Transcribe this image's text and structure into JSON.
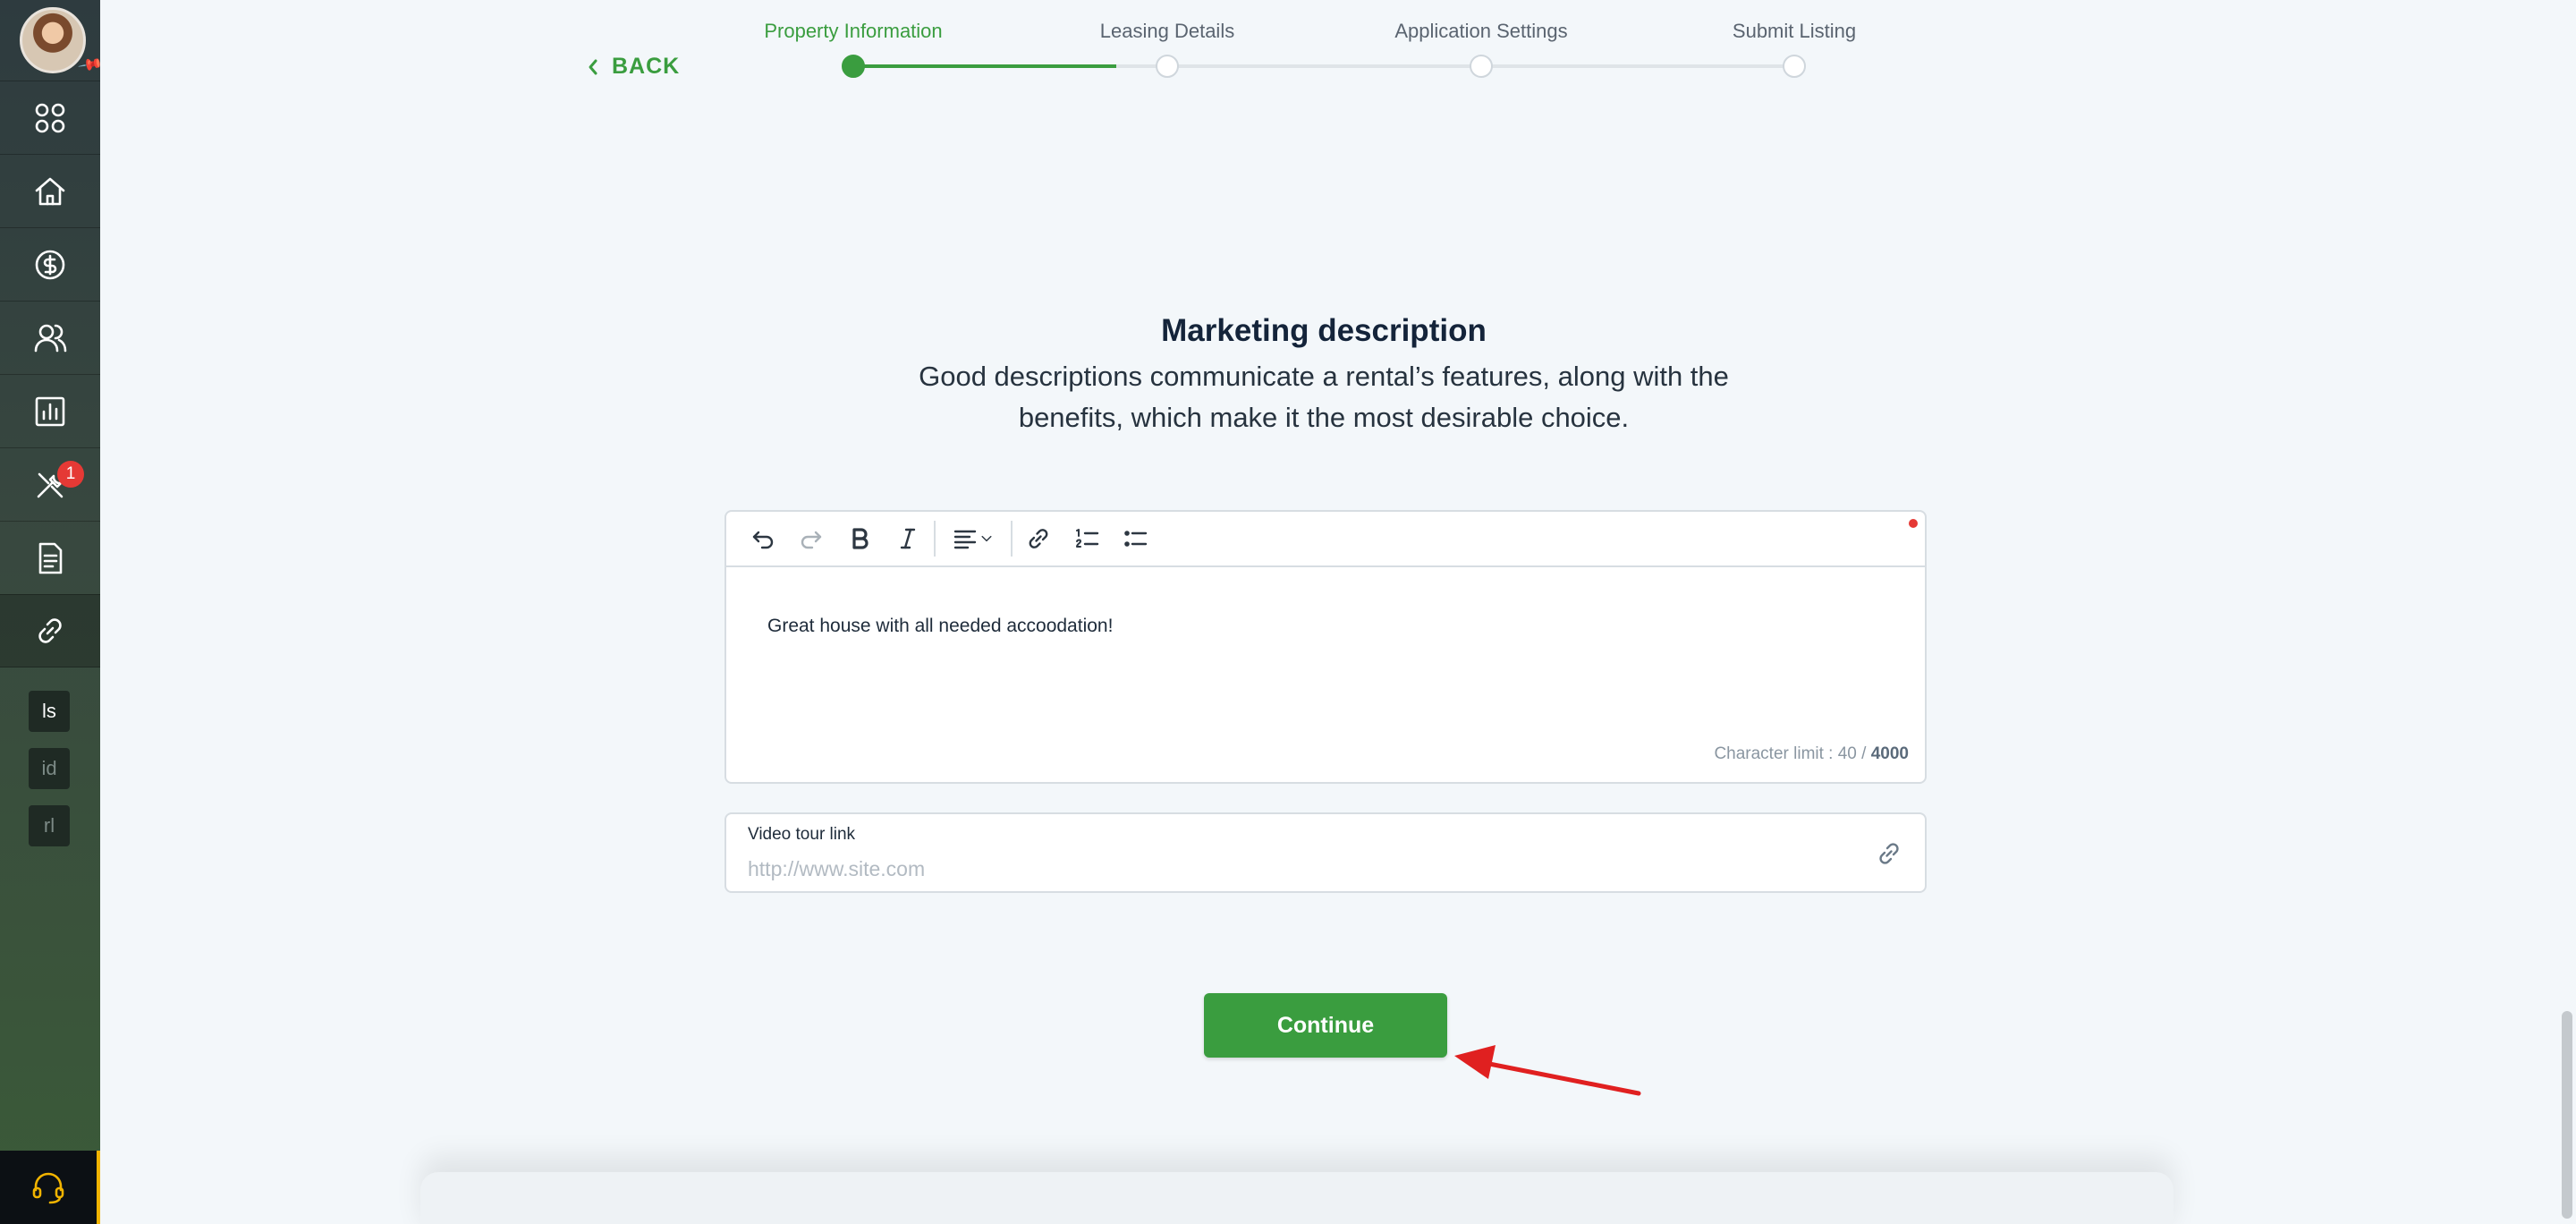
{
  "stepper": {
    "back_label": "BACK",
    "steps": [
      {
        "label": "Property Information",
        "state": "current"
      },
      {
        "label": "Leasing Details",
        "state": "upcoming"
      },
      {
        "label": "Application Settings",
        "state": "upcoming"
      },
      {
        "label": "Submit Listing",
        "state": "upcoming"
      }
    ]
  },
  "sidebar": {
    "items": [
      {
        "icon": "grid-icon"
      },
      {
        "icon": "home-icon"
      },
      {
        "icon": "dollar-icon"
      },
      {
        "icon": "users-icon"
      },
      {
        "icon": "chart-icon"
      },
      {
        "icon": "tools-icon",
        "badge": "1"
      },
      {
        "icon": "document-icon"
      },
      {
        "icon": "link-icon",
        "active": true
      }
    ],
    "mini_items": [
      "ls",
      "id",
      "rl"
    ],
    "help_icon": "headset-icon"
  },
  "section": {
    "title": "Marketing description",
    "subtitle_line1": "Good descriptions communicate a rental’s features, along with the",
    "subtitle_line2": "benefits, which make it the most desirable choice."
  },
  "editor": {
    "content": "Great house with all needed accoodation!",
    "char_limit_prefix": "Character limit : 40 /",
    "char_limit_max": "4000",
    "toolbar": [
      "undo-icon",
      "redo-icon",
      "bold-icon",
      "italic-icon",
      "align-left-icon",
      "link-icon",
      "ordered-list-icon",
      "bullet-list-icon"
    ]
  },
  "video": {
    "label": "Video tour link",
    "placeholder": "http://www.site.com",
    "value": ""
  },
  "actions": {
    "continue_label": "Continue"
  },
  "colors": {
    "accent": "#3a9d3f",
    "annotation_arrow": "#e02020",
    "badge": "#e53935",
    "help_accent": "#f2b400"
  }
}
